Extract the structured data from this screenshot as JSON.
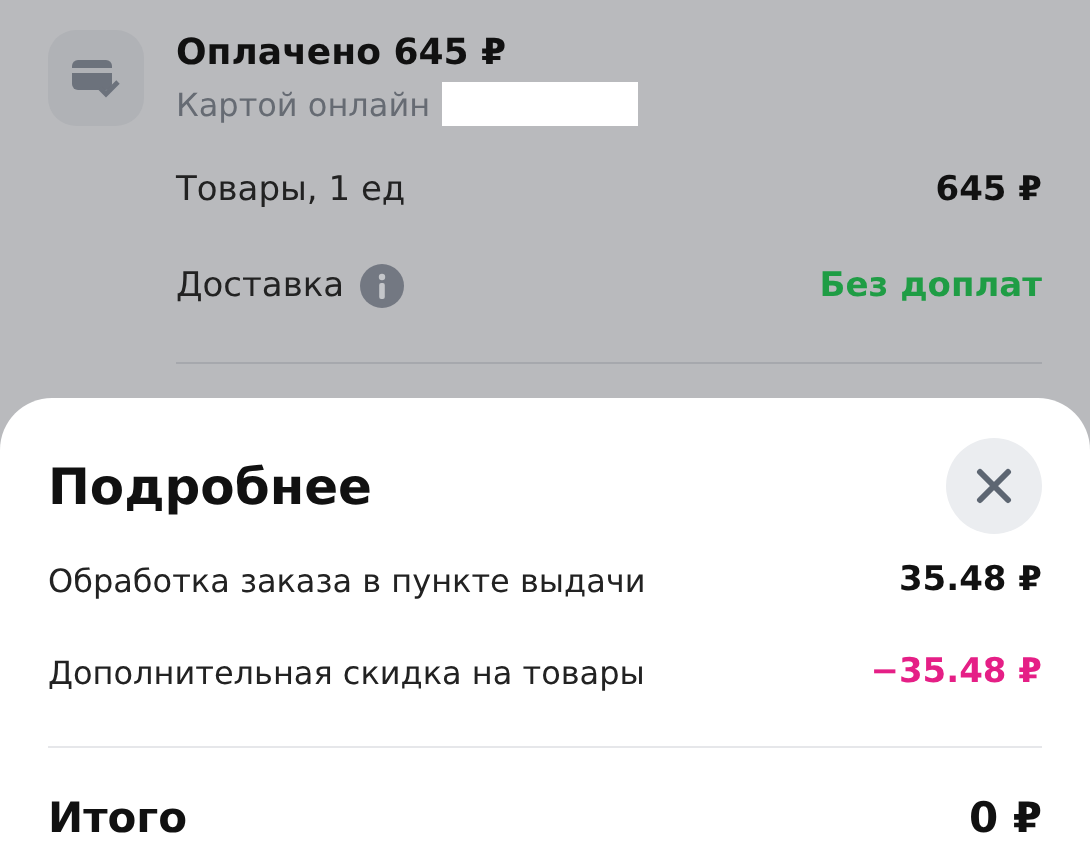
{
  "payment": {
    "title": "Оплачено 645 ₽",
    "method": "Картой онлайн",
    "redacted": true
  },
  "summary": [
    {
      "label": "Товары, 1 ед",
      "value": "645 ₽",
      "info": false,
      "color": "#111111"
    },
    {
      "label": "Доставка",
      "value": "Без доплат",
      "info": true,
      "color": "#1f9d45"
    }
  ],
  "sheet": {
    "title": "Подробнее",
    "rows": [
      {
        "label": "Обработка заказа в пункте выдачи",
        "value": "35.48 ₽",
        "color": "#111111"
      },
      {
        "label": "Дополнительная скидка на товары",
        "value": "−35.48 ₽",
        "color": "#e51f86"
      }
    ],
    "total": {
      "label": "Итого",
      "value": "0 ₽"
    }
  }
}
